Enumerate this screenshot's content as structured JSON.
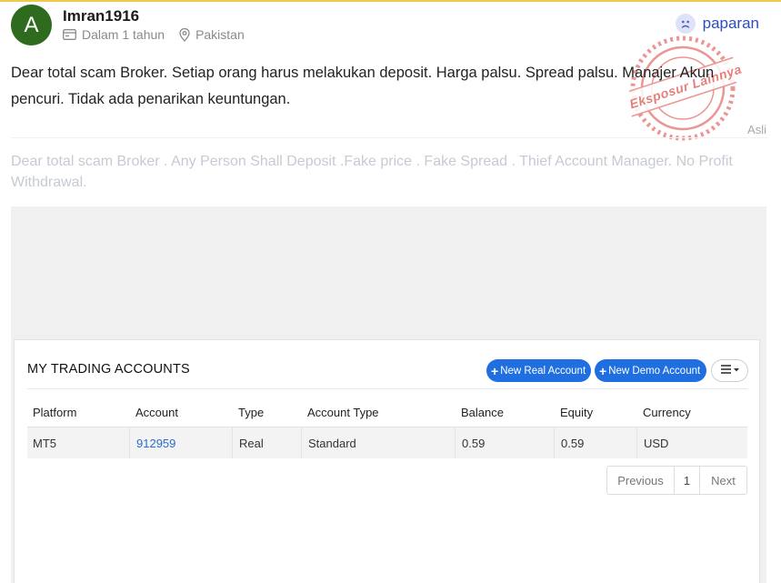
{
  "user": {
    "avatar_letter": "A",
    "name": "Imran1916",
    "time": "Dalam 1 tahun",
    "location": "Pakistan"
  },
  "exposure": {
    "label": "paparan",
    "stamp_text": "Eksposur Lainnya"
  },
  "review": {
    "text": "Dear total scam Broker. Setiap orang harus melakukan deposit. Harga palsu. Spread palsu. Manajer Akun pencuri. Tidak ada penarikan keuntungan.",
    "original_label": "Asli",
    "original_text": "Dear total scam Broker . Any Person Shall Deposit .Fake price . Fake Spread . Thief Account Manager. No Profit Withdrawal."
  },
  "accounts_panel": {
    "title": "MY TRADING ACCOUNTS",
    "new_real_label": "New Real Account",
    "new_demo_label": "New Demo Account",
    "columns": [
      "Platform",
      "Account",
      "Type",
      "Account Type",
      "Balance",
      "Equity",
      "Currency"
    ],
    "rows": [
      {
        "platform": "MT5",
        "account": "912959",
        "type": "Real",
        "account_type": "Standard",
        "balance": "0.59",
        "equity": "0.59",
        "currency": "USD"
      }
    ],
    "pagination": {
      "previous": "Previous",
      "page": "1",
      "next": "Next"
    }
  },
  "colors": {
    "avatar": "#2e6b1f",
    "accent_blue": "#1f6fe0",
    "stamp_red": "#d9423c",
    "link_blue": "#2a6ccf"
  }
}
